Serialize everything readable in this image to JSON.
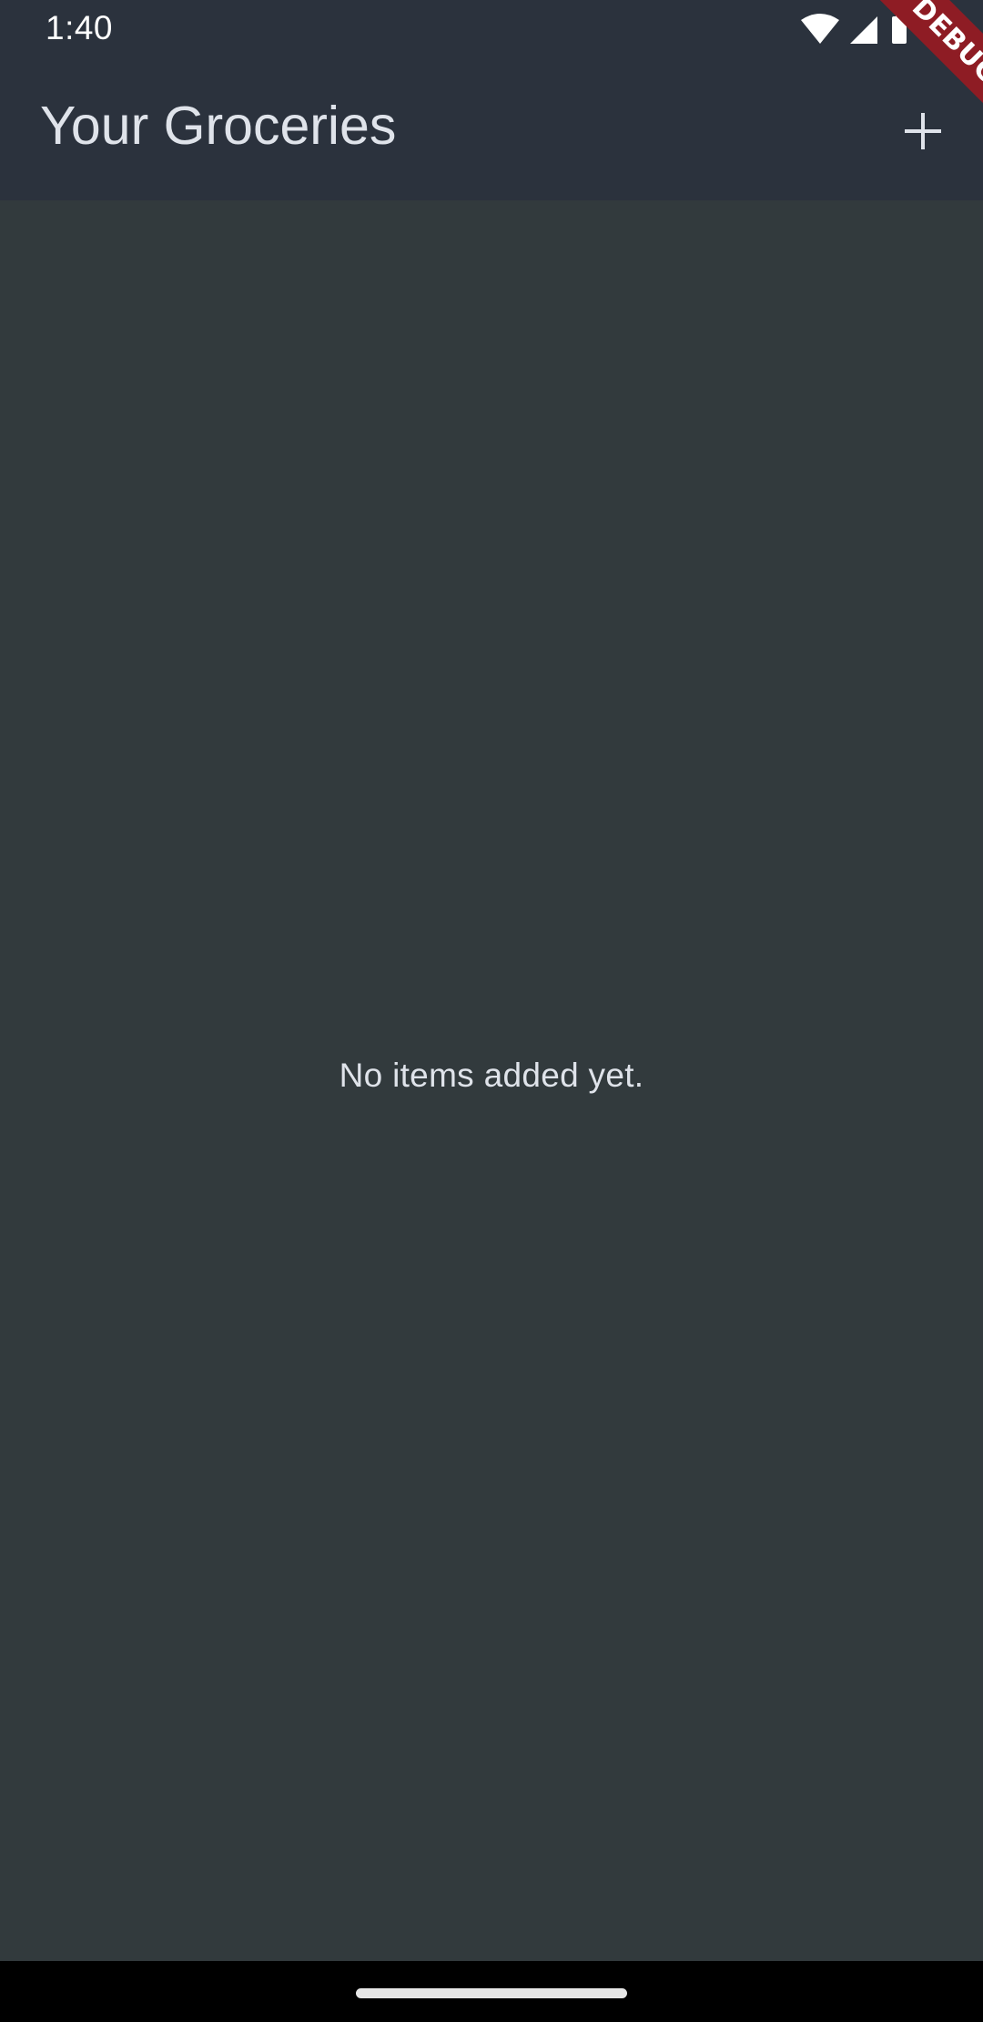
{
  "status_bar": {
    "time": "1:40",
    "icons": [
      "wifi-icon",
      "signal-icon",
      "battery-icon"
    ]
  },
  "app_bar": {
    "title": "Your Groceries",
    "action_icon": "add-icon"
  },
  "content": {
    "empty_message": "No items added yet."
  },
  "debug_banner": {
    "label": "DEBUG"
  },
  "colors": {
    "app_bar_background": "#2b323d",
    "page_background": "#323a3d",
    "text": "#dfe3ea",
    "debug_banner": "#8e1c24"
  }
}
